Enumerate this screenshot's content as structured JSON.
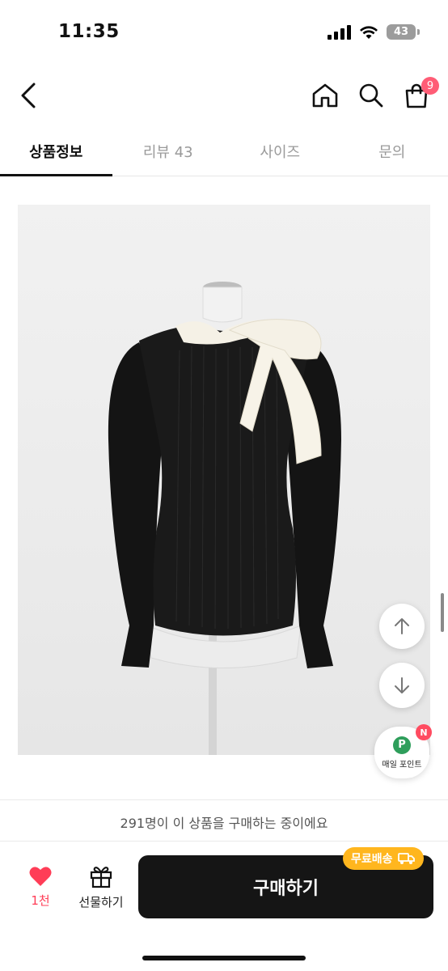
{
  "status_bar": {
    "time": "11:35",
    "battery": "43"
  },
  "header": {
    "cart_count": "9"
  },
  "tabs": [
    {
      "label": "상품정보",
      "active": true
    },
    {
      "label": "리뷰 43",
      "active": false
    },
    {
      "label": "사이즈",
      "active": false
    },
    {
      "label": "문의",
      "active": false
    }
  ],
  "floating": {
    "point_icon": "P",
    "point_label": "매일 포인트",
    "new_badge": "N"
  },
  "buyer_banner": "291명이 이 상품을 구매하는 중이에요",
  "bottom_bar": {
    "like_count": "1천",
    "gift_label": "선물하기",
    "buy_label": "구매하기",
    "shipping_badge": "무료배송"
  },
  "colors": {
    "accent": "#ff3d57",
    "buy_button": "#151515",
    "shipping_badge": "#ffb61e",
    "point_green": "#2e9e5b"
  }
}
